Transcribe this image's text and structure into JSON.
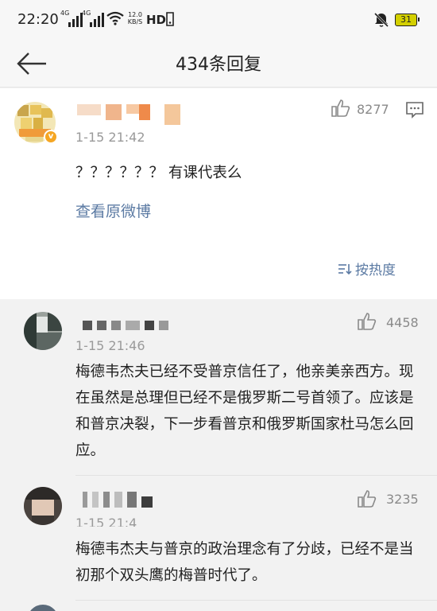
{
  "status": {
    "time": "22:20",
    "net1": "4G",
    "net2": "4G",
    "speed_top": "12.0",
    "speed_bottom": "KB/S",
    "hd": "HD",
    "battery": "31"
  },
  "nav": {
    "title": "434条回复"
  },
  "post": {
    "time": "1-15 21:42",
    "likes": "8277",
    "text": "？？？？？？ 有课代表么",
    "link": "查看原微博",
    "sort": "按热度"
  },
  "comments": [
    {
      "time": "1-15 21:46",
      "likes": "4458",
      "text": "梅德韦杰夫已经不受普京信任了，他亲美亲西方。现在虽然是总理但已经不是俄罗斯二号首领了。应该是和普京决裂，下一步看普京和俄罗斯国家杜马怎么回应。"
    },
    {
      "time": "1-15 21:4",
      "likes": "3235",
      "text": "梅德韦杰夫与普京的政治理念有了分歧，已经不是当初那个双头鹰的梅普时代了。"
    }
  ]
}
